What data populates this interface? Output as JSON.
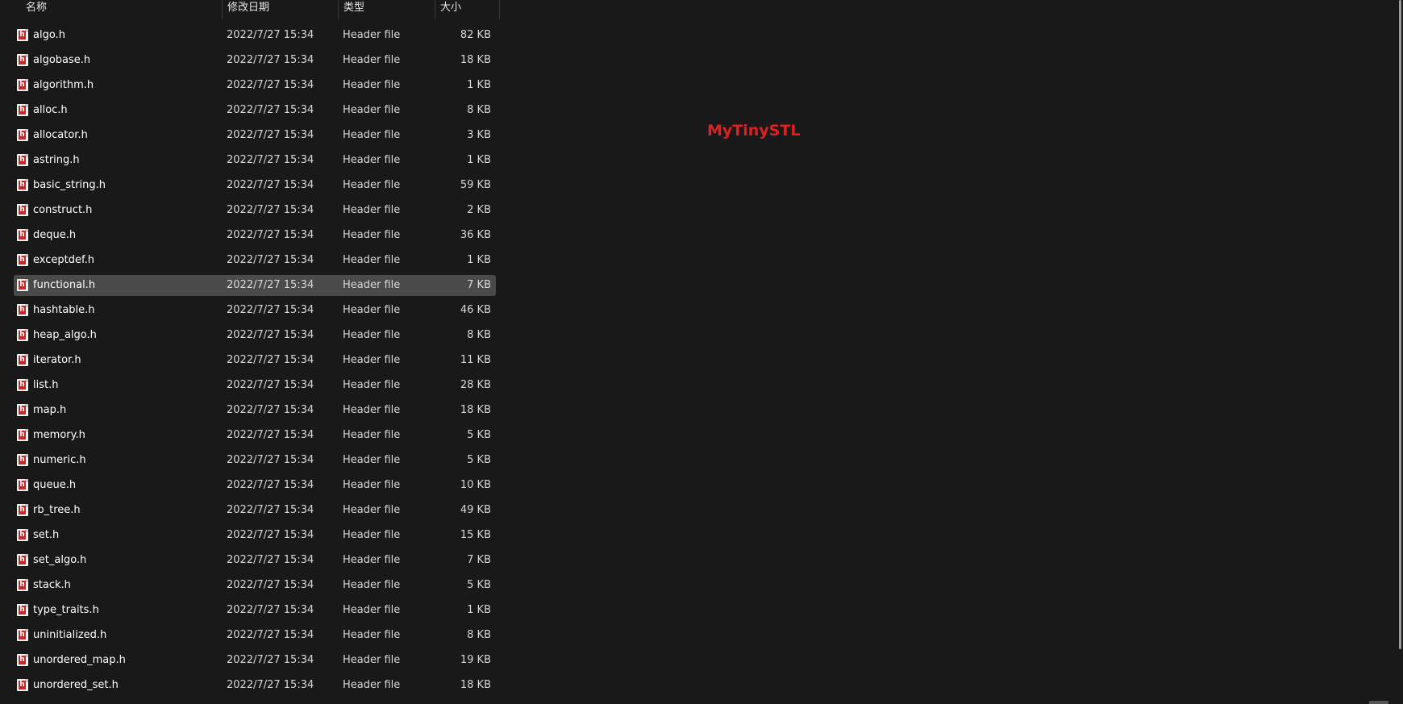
{
  "columns": {
    "name": "名称",
    "date": "修改日期",
    "type": "类型",
    "size": "大小"
  },
  "overlay_text": "MyTinySTL",
  "accent_color": "#e02020",
  "selected_index": 10,
  "files": [
    {
      "name": "algo.h",
      "date": "2022/7/27 15:34",
      "type": "Header file",
      "size": "82 KB"
    },
    {
      "name": "algobase.h",
      "date": "2022/7/27 15:34",
      "type": "Header file",
      "size": "18 KB"
    },
    {
      "name": "algorithm.h",
      "date": "2022/7/27 15:34",
      "type": "Header file",
      "size": "1 KB"
    },
    {
      "name": "alloc.h",
      "date": "2022/7/27 15:34",
      "type": "Header file",
      "size": "8 KB"
    },
    {
      "name": "allocator.h",
      "date": "2022/7/27 15:34",
      "type": "Header file",
      "size": "3 KB"
    },
    {
      "name": "astring.h",
      "date": "2022/7/27 15:34",
      "type": "Header file",
      "size": "1 KB"
    },
    {
      "name": "basic_string.h",
      "date": "2022/7/27 15:34",
      "type": "Header file",
      "size": "59 KB"
    },
    {
      "name": "construct.h",
      "date": "2022/7/27 15:34",
      "type": "Header file",
      "size": "2 KB"
    },
    {
      "name": "deque.h",
      "date": "2022/7/27 15:34",
      "type": "Header file",
      "size": "36 KB"
    },
    {
      "name": "exceptdef.h",
      "date": "2022/7/27 15:34",
      "type": "Header file",
      "size": "1 KB"
    },
    {
      "name": "functional.h",
      "date": "2022/7/27 15:34",
      "type": "Header file",
      "size": "7 KB"
    },
    {
      "name": "hashtable.h",
      "date": "2022/7/27 15:34",
      "type": "Header file",
      "size": "46 KB"
    },
    {
      "name": "heap_algo.h",
      "date": "2022/7/27 15:34",
      "type": "Header file",
      "size": "8 KB"
    },
    {
      "name": "iterator.h",
      "date": "2022/7/27 15:34",
      "type": "Header file",
      "size": "11 KB"
    },
    {
      "name": "list.h",
      "date": "2022/7/27 15:34",
      "type": "Header file",
      "size": "28 KB"
    },
    {
      "name": "map.h",
      "date": "2022/7/27 15:34",
      "type": "Header file",
      "size": "18 KB"
    },
    {
      "name": "memory.h",
      "date": "2022/7/27 15:34",
      "type": "Header file",
      "size": "5 KB"
    },
    {
      "name": "numeric.h",
      "date": "2022/7/27 15:34",
      "type": "Header file",
      "size": "5 KB"
    },
    {
      "name": "queue.h",
      "date": "2022/7/27 15:34",
      "type": "Header file",
      "size": "10 KB"
    },
    {
      "name": "rb_tree.h",
      "date": "2022/7/27 15:34",
      "type": "Header file",
      "size": "49 KB"
    },
    {
      "name": "set.h",
      "date": "2022/7/27 15:34",
      "type": "Header file",
      "size": "15 KB"
    },
    {
      "name": "set_algo.h",
      "date": "2022/7/27 15:34",
      "type": "Header file",
      "size": "7 KB"
    },
    {
      "name": "stack.h",
      "date": "2022/7/27 15:34",
      "type": "Header file",
      "size": "5 KB"
    },
    {
      "name": "type_traits.h",
      "date": "2022/7/27 15:34",
      "type": "Header file",
      "size": "1 KB"
    },
    {
      "name": "uninitialized.h",
      "date": "2022/7/27 15:34",
      "type": "Header file",
      "size": "8 KB"
    },
    {
      "name": "unordered_map.h",
      "date": "2022/7/27 15:34",
      "type": "Header file",
      "size": "19 KB"
    },
    {
      "name": "unordered_set.h",
      "date": "2022/7/27 15:34",
      "type": "Header file",
      "size": "18 KB"
    }
  ]
}
